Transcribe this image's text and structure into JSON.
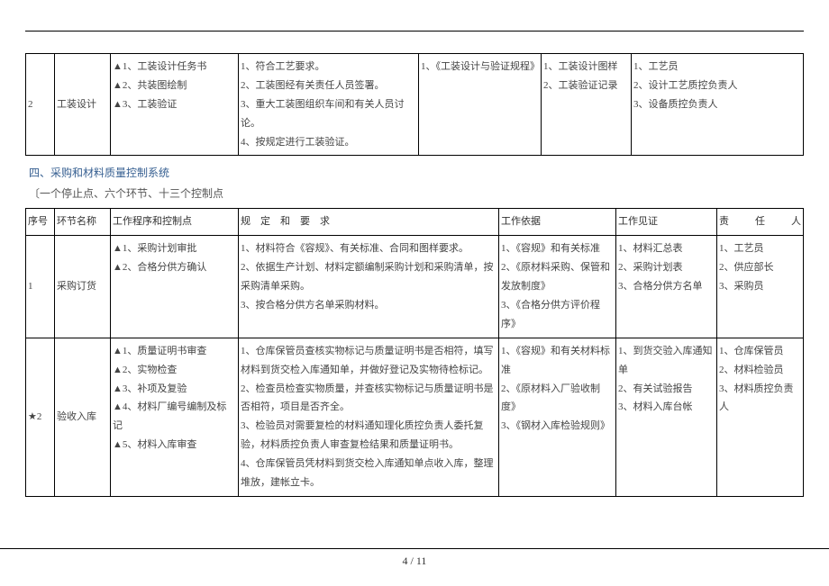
{
  "header_dots": ".   .   .",
  "table1": {
    "row": {
      "num": "2",
      "name": "工装设计",
      "ctrl": [
        "▲1、工装设计任务书",
        "▲2、共装图绘制",
        "▲3、工装验证"
      ],
      "req": [
        "1、符合工艺要求。",
        "2、工装图经有关责任人员签署。",
        "3、重大工装图组织车间和有关人员讨论。",
        "4、按规定进行工装验证。"
      ],
      "basis": [
        "1、《工装设计与验证规程》"
      ],
      "wit": [
        "1、工装设计图样",
        "2、工装验证记录"
      ],
      "resp": [
        "1、工艺员",
        "2、设计工艺质控负责人",
        "3、设备质控负责人"
      ]
    }
  },
  "section4": {
    "title": "四、采购和材料质量控制系统",
    "subtitle": "〔一个停止点、六个环节、十三个控制点"
  },
  "table2": {
    "head": {
      "num": "序号",
      "name": "环节名称",
      "ctrl": "工作程序和控制点",
      "req": "规　定　和　要　求",
      "basis": "工作依据",
      "wit": "工作见证",
      "resp": "责　任　人"
    },
    "rows": [
      {
        "num": "1",
        "name": "采购订货",
        "ctrl": [
          "▲1、采购计划审批",
          "▲2、合格分供方确认"
        ],
        "req": [
          "1、材料符合《容规》、有关标准、合同和图样要求。",
          "2、依据生产计划、材料定额编制采购计划和采购清单，按采购清单采购。",
          "3、按合格分供方名单采购材料。"
        ],
        "basis": [
          "1、《容规》和有关标准",
          "2、《原材料采购、保管和发放制度》",
          "3、《合格分供方评价程序》"
        ],
        "wit": [
          "1、材料汇总表",
          "2、采购计划表",
          "3、合格分供方名单"
        ],
        "resp": [
          "1、工艺员",
          "2、供应部长",
          "3、采购员"
        ]
      },
      {
        "num": "★2",
        "name": "验收入库",
        "ctrl": [
          "▲1、质量证明书审查",
          "▲2、实物检查",
          "▲3、补项及复验",
          "▲4、材料厂编号编制及标记",
          "▲5、材料入库审查"
        ],
        "req": [
          "1、仓库保管员查核实物标记与质量证明书是否相符，填写材料到货交检入库通知单，并做好登记及实物待检标记。",
          "2、检查员检查实物质量，并查核实物标记与质量证明书是否相符，项目是否齐全。",
          "3、检验员对需要复检的材料通知理化质控负责人委托复验，材料质控负责人审查复检结果和质量证明书。",
          "4、仓库保管员凭材料到货交检入库通知单点收入库，整理堆放，建帐立卡。"
        ],
        "basis": [
          "1、《容规》和有关材料标准",
          "2、《原材料入厂验收制度》",
          "3、《钢材入库检验规则》"
        ],
        "wit": [
          "1、到货交验入库通知单",
          "2、有关试验报告",
          "3、材料入库台帐"
        ],
        "resp": [
          "1、仓库保管员",
          "2、材料检验员",
          "3、材料质控负责人"
        ]
      }
    ]
  },
  "footer": "4 / 11"
}
